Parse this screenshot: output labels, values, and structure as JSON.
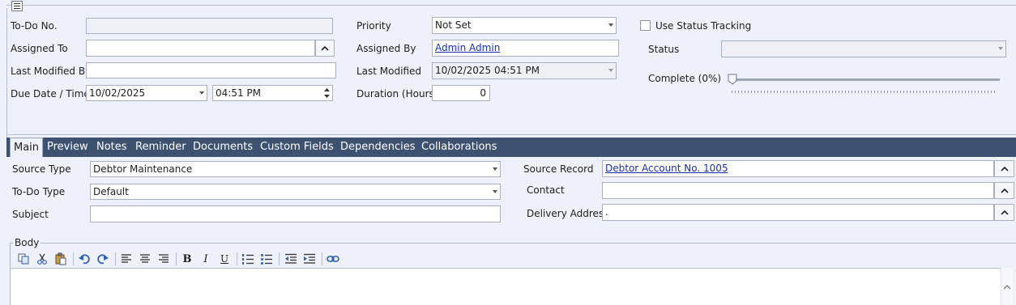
{
  "header": {
    "todo_no": {
      "label": "To-Do No.",
      "value": ""
    },
    "assigned_to": {
      "label": "Assigned To",
      "value": ""
    },
    "last_modified_by": {
      "label": "Last Modified By",
      "value": ""
    },
    "due": {
      "label": "Due Date / Time",
      "date": "10/02/2025",
      "time": "04:51 PM"
    },
    "priority": {
      "label": "Priority",
      "value": "Not Set"
    },
    "assigned_by": {
      "label": "Assigned By",
      "value": "Admin Admin"
    },
    "last_modified": {
      "label": "Last Modified",
      "value": "10/02/2025 04:51 PM"
    },
    "duration": {
      "label": "Duration (Hours)",
      "value": "0"
    },
    "status_tracking": {
      "label": "Use Status Tracking",
      "checked": false
    },
    "status": {
      "label": "Status",
      "value": ""
    },
    "complete": {
      "label": "Complete (0%)",
      "percent": 0
    }
  },
  "tabs": [
    {
      "label": "Main",
      "active": true
    },
    {
      "label": "Preview"
    },
    {
      "label": "Notes"
    },
    {
      "label": "Reminder"
    },
    {
      "label": "Documents"
    },
    {
      "label": "Custom Fields"
    },
    {
      "label": "Dependencies"
    },
    {
      "label": "Collaborations"
    }
  ],
  "main": {
    "source_type": {
      "label": "Source Type",
      "value": "Debtor Maintenance"
    },
    "todo_type": {
      "label": "To-Do Type",
      "value": "Default"
    },
    "subject": {
      "label": "Subject",
      "value": ""
    },
    "source_record": {
      "label": "Source Record",
      "value": "Debtor Account No. 1005"
    },
    "contact": {
      "label": "Contact",
      "value": ""
    },
    "delivery_address": {
      "label": "Delivery Address",
      "value": "."
    },
    "body": {
      "label": "Body"
    }
  },
  "toolbar_icons": [
    "copy-icon",
    "cut-icon",
    "paste-icon",
    "undo-icon",
    "redo-icon",
    "align-left-icon",
    "align-center-icon",
    "align-right-icon",
    "bold-icon",
    "italic-icon",
    "underline-icon",
    "numbered-list-icon",
    "bullet-list-icon",
    "outdent-icon",
    "indent-icon",
    "link-icon"
  ],
  "toolbar_glyphs": {
    "bold": "B",
    "italic": "I",
    "underline": "U"
  }
}
